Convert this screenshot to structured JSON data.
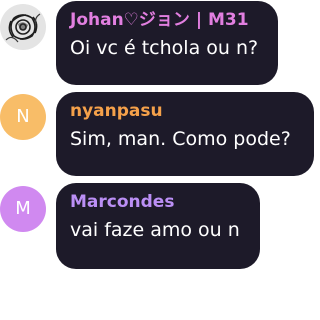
{
  "colors": {
    "bubble_background": "#1d1a29",
    "message_text": "#ffffff",
    "page_background": "#ffffff"
  },
  "messages": [
    {
      "author": "Johan♡ジョン | M31",
      "author_color": "#e27fe0",
      "text": "Oi vc é tchola ou n?",
      "avatar": {
        "type": "image",
        "icon": "rose-avatar-icon",
        "color": "#bdbdbd"
      }
    },
    {
      "author": "nyanpasu",
      "author_color": "#f5a14a",
      "text": "Sim, man. Como pode?",
      "avatar": {
        "type": "letter",
        "letter": "N",
        "color": "#f8bd68"
      }
    },
    {
      "author": "Marcondes",
      "author_color": "#bb8ff5",
      "text": "vai faze amo ou n",
      "avatar": {
        "type": "letter",
        "letter": "M",
        "color": "#d089f0"
      }
    }
  ]
}
